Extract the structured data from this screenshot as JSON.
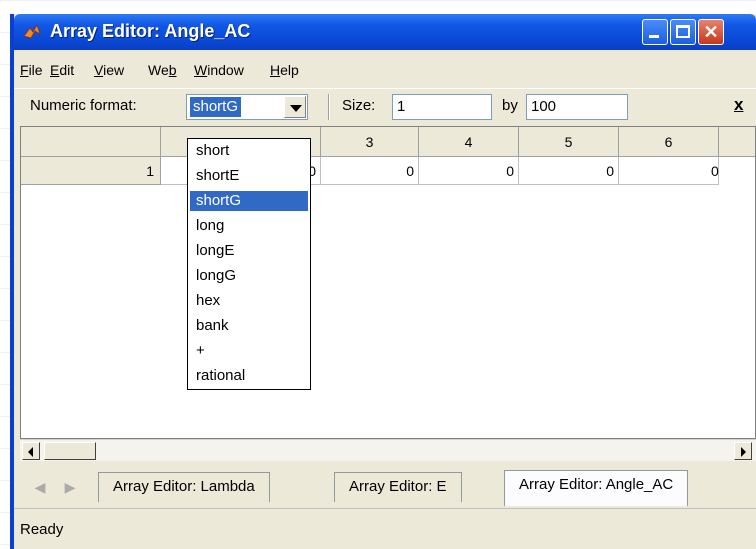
{
  "window": {
    "title": "Array Editor: Angle_AC"
  },
  "menubar": {
    "items": [
      {
        "label": "File",
        "mnemonic": "F",
        "rest": "ile"
      },
      {
        "label": "Edit",
        "mnemonic": "E",
        "rest": "dit"
      },
      {
        "label": "View",
        "mnemonic": "V",
        "rest": "iew"
      },
      {
        "label": "Web",
        "mnemonic": "b",
        "prefix": "We"
      },
      {
        "label": "Window",
        "mnemonic": "W",
        "rest": "indow"
      },
      {
        "label": "Help",
        "mnemonic": "H",
        "rest": "elp"
      }
    ]
  },
  "toolbar": {
    "numeric_format_label": "Numeric format:",
    "numeric_format_value": "shortG",
    "size_label": "Size:",
    "size_rows": "1",
    "by_label": "by",
    "size_cols": "100",
    "close_label": "x"
  },
  "format_dropdown": {
    "options": [
      "short",
      "shortE",
      "shortG",
      "long",
      "longE",
      "longG",
      "hex",
      "bank",
      "+",
      "rational"
    ],
    "selected": "shortG"
  },
  "grid": {
    "column_headers": [
      "",
      "3",
      "4",
      "5",
      "6"
    ],
    "row_header": "1",
    "row_values": [
      "0",
      "0",
      "0",
      "0",
      "0"
    ]
  },
  "tabs": [
    {
      "label": "Array Editor: Lambda",
      "active": false
    },
    {
      "label": "Array Editor: E",
      "active": false
    },
    {
      "label": "Array Editor: Angle_AC",
      "active": true
    }
  ],
  "status": {
    "text": "Ready"
  },
  "colors": {
    "title_bar": "#0a4ad8",
    "selection": "#316ac5",
    "chrome": "#ece9d8"
  }
}
